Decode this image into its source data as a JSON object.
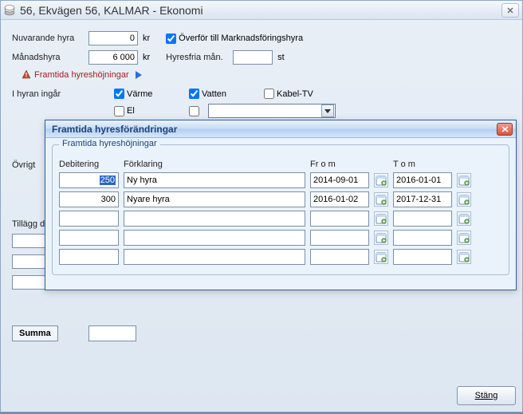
{
  "main": {
    "title": "56, Ekvägen 56, KALMAR - Ekonomi",
    "labels": {
      "nuvarande_hyra": "Nuvarande hyra",
      "manadshyra": "Månadshyra",
      "kr": "kr",
      "overfor": "Överför till Marknadsföringshyra",
      "hyresfria": "Hyresfria mån.",
      "st": "st",
      "warning": "Framtida hyreshöjningar",
      "i_hyran_ingar": "I hyran ingår",
      "varme": "Värme",
      "vatten": "Vatten",
      "kabeltv": "Kabel-TV",
      "el": "El",
      "ovrigt": "Övrigt",
      "tillagg": "Tillägg d",
      "summa": "Summa",
      "stang_accel": "S",
      "stang_rest": "täng"
    },
    "fields": {
      "nuvarande_hyra": "0",
      "manadshyra": "6 000",
      "hyresfria": ""
    },
    "checks": {
      "overfor": true,
      "varme": true,
      "vatten": true,
      "kabeltv": false,
      "el": false,
      "extra": false
    }
  },
  "dialog": {
    "title": "Framtida hyresförändringar",
    "group": "Framtida hyreshöjningar",
    "headers": {
      "debitering": "Debitering",
      "forklaring": "Förklaring",
      "from": "Fr o m",
      "tom": "T o m"
    },
    "rows": [
      {
        "deb": "250",
        "desc": "Ny hyra",
        "from": "2014-09-01",
        "tom": "2016-01-01",
        "selected": true
      },
      {
        "deb": "300",
        "desc": "Nyare hyra",
        "from": "2016-01-02",
        "tom": "2017-12-31",
        "selected": false
      },
      {
        "deb": "",
        "desc": "",
        "from": "",
        "tom": "",
        "selected": false
      },
      {
        "deb": "",
        "desc": "",
        "from": "",
        "tom": "",
        "selected": false
      },
      {
        "deb": "",
        "desc": "",
        "from": "",
        "tom": "",
        "selected": false
      }
    ]
  }
}
